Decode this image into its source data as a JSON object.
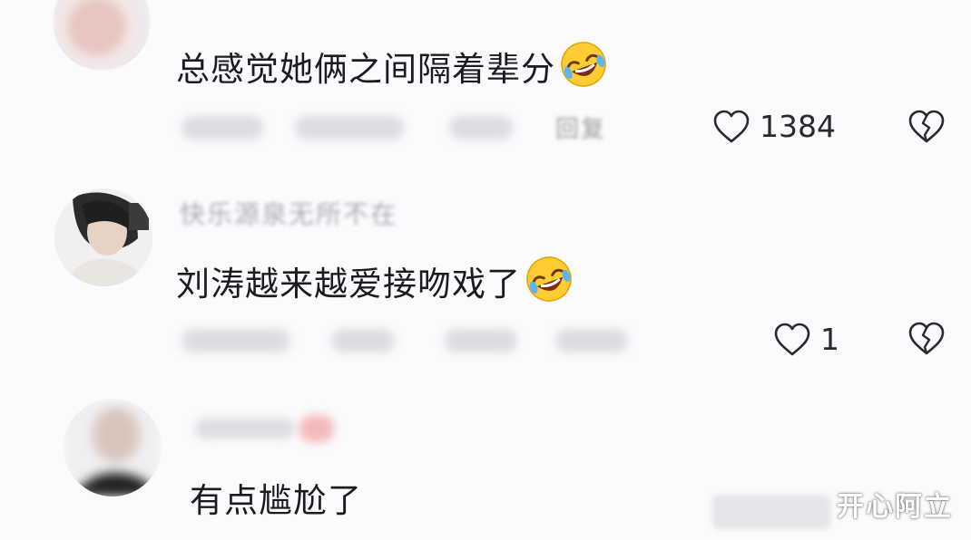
{
  "comments": [
    {
      "text": "总感觉她俩之间隔着辈分",
      "emoji": "rolling-on-floor-laughing-icon",
      "reply_label": "回复",
      "likes": "1384"
    },
    {
      "username": "快乐源泉无所不在",
      "text": "刘涛越来越爱接吻戏了",
      "emoji": "rolling-on-floor-laughing-icon",
      "likes": "1"
    },
    {
      "text": "有点尴尬了"
    }
  ],
  "watermark": "开心阿立",
  "colors": {
    "background": "#fbfbfd",
    "text": "#1c1c20",
    "icon": "#2a2a2e",
    "emoji_face": "#ffcc33"
  }
}
